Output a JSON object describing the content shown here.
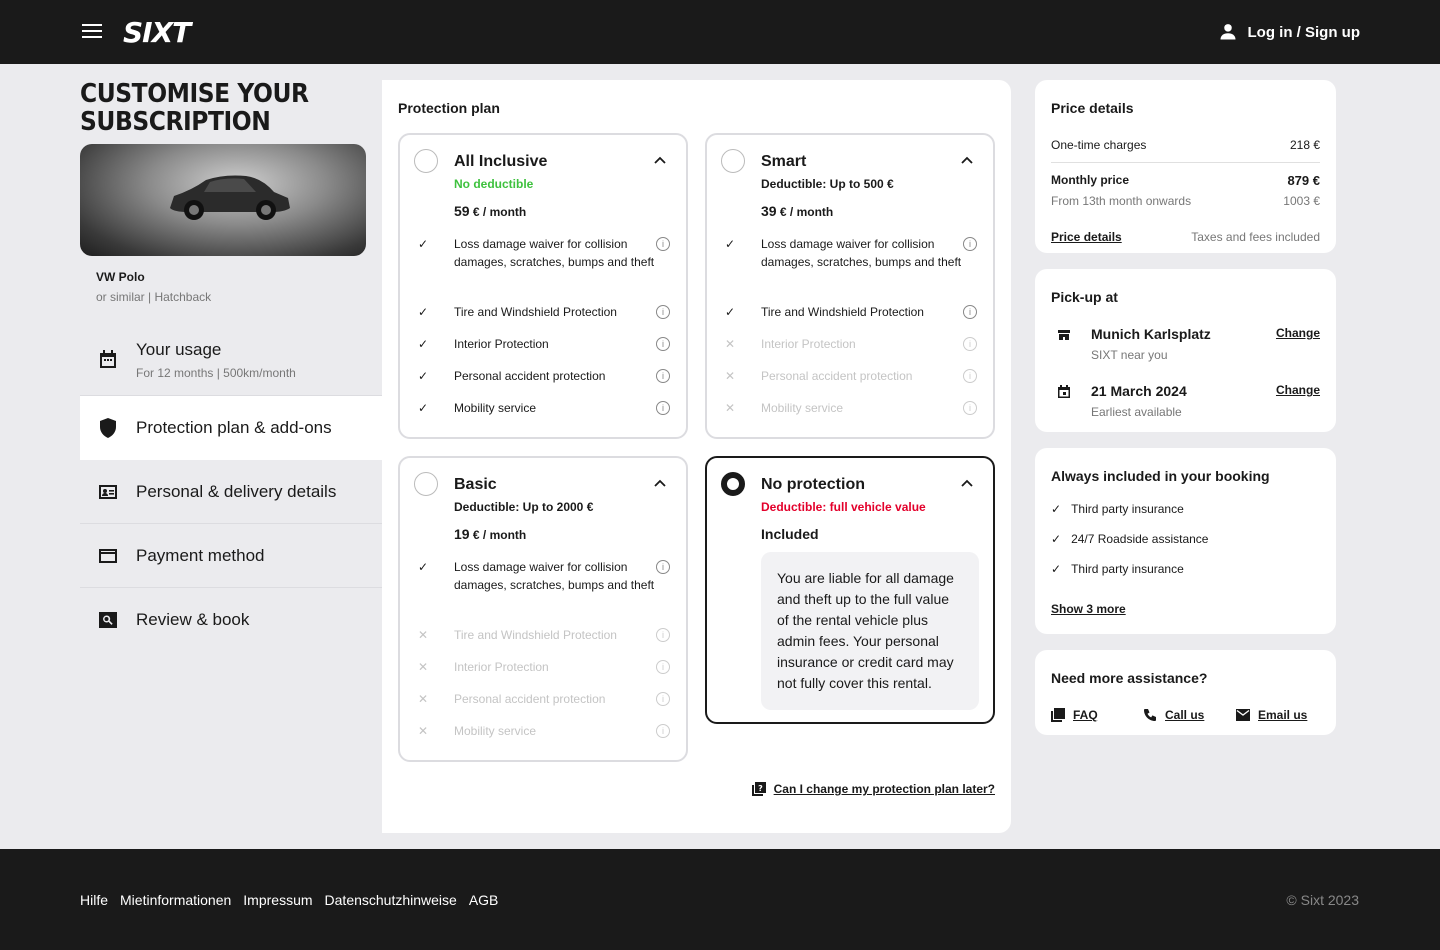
{
  "header": {
    "logo": "SIXT",
    "login_label": "Log in / Sign up"
  },
  "left": {
    "title": "CUSTOMISE YOUR SUBSCRIPTION",
    "car_name": "VW Polo",
    "car_sub": "or similar | Hatchback",
    "nav": [
      {
        "label": "Your usage",
        "sub": "For 12 months | 500km/month",
        "icon": "calendar-icon"
      },
      {
        "label": "Protection plan & add-ons",
        "icon": "shield-icon"
      },
      {
        "label": "Personal & delivery details",
        "icon": "id-card-icon"
      },
      {
        "label": "Payment method",
        "icon": "credit-card-icon"
      },
      {
        "label": "Review & book",
        "icon": "search-icon"
      }
    ]
  },
  "protection": {
    "title": "Protection plan",
    "plans": [
      {
        "name": "All Inclusive",
        "deductible": "No deductible",
        "deductible_color": "#3ec13e",
        "price": "59",
        "price_unit": "€ / month",
        "features": [
          "Loss damage waiver for collision damages, scratches, bumps and theft",
          "Tire and Windshield Protection",
          "Interior Protection",
          "Personal accident protection",
          "Mobility service"
        ]
      },
      {
        "name": "Smart",
        "deductible": "Deductible: Up to 500 €",
        "price": "39",
        "price_unit": "€ / month",
        "features": [
          "Loss damage waiver for collision damages, scratches, bumps and theft",
          "Tire and Windshield Protection",
          "Interior Protection",
          "Personal accident protection",
          "Mobility service"
        ]
      },
      {
        "name": "Basic",
        "deductible": "Deductible: Up to 2000 €",
        "price": "19",
        "price_unit": "€ / month",
        "features": [
          "Loss damage waiver for collision damages, scratches, bumps and theft",
          "Tire and Windshield Protection",
          "Interior Protection",
          "Personal accident protection",
          "Mobility service"
        ]
      },
      {
        "name": "No protection",
        "deductible": "Deductible: full vehicle value",
        "deductible_color": "#e3002b",
        "included": "Included",
        "note": "You are liable for all damage and theft up to the full value of the rental vehicle plus admin fees. Your personal insurance or credit card may not fully cover this rental."
      }
    ],
    "faq_link": "Can I change my protection plan later?"
  },
  "price": {
    "title": "Price details",
    "one_time_label": "One-time charges",
    "one_time_value": "218 €",
    "monthly_label": "Monthly price",
    "monthly_value": "879 €",
    "from13_label": "From 13th month onwards",
    "from13_value": "1003 €",
    "details_link": "Price details",
    "taxes": "Taxes and fees included"
  },
  "pickup": {
    "title": "Pick-up at",
    "location": "Munich Karlsplatz",
    "location_sub": "SIXT near you",
    "date": "21 March 2024",
    "date_sub": "Earliest available",
    "change": "Change"
  },
  "included": {
    "title": "Always included in your booking",
    "items": [
      "Third party insurance",
      "24/7 Roadside assistance",
      "Third party insurance"
    ],
    "more": "Show 3 more"
  },
  "assist": {
    "title": "Need more assistance?",
    "faq": "FAQ",
    "call": "Call us",
    "email": "Email us"
  },
  "footer": {
    "links": [
      "Hilfe",
      "Mietinformationen",
      "Impressum",
      "Datenschutzhinweise",
      "AGB"
    ],
    "copy": "© Sixt 2023"
  }
}
